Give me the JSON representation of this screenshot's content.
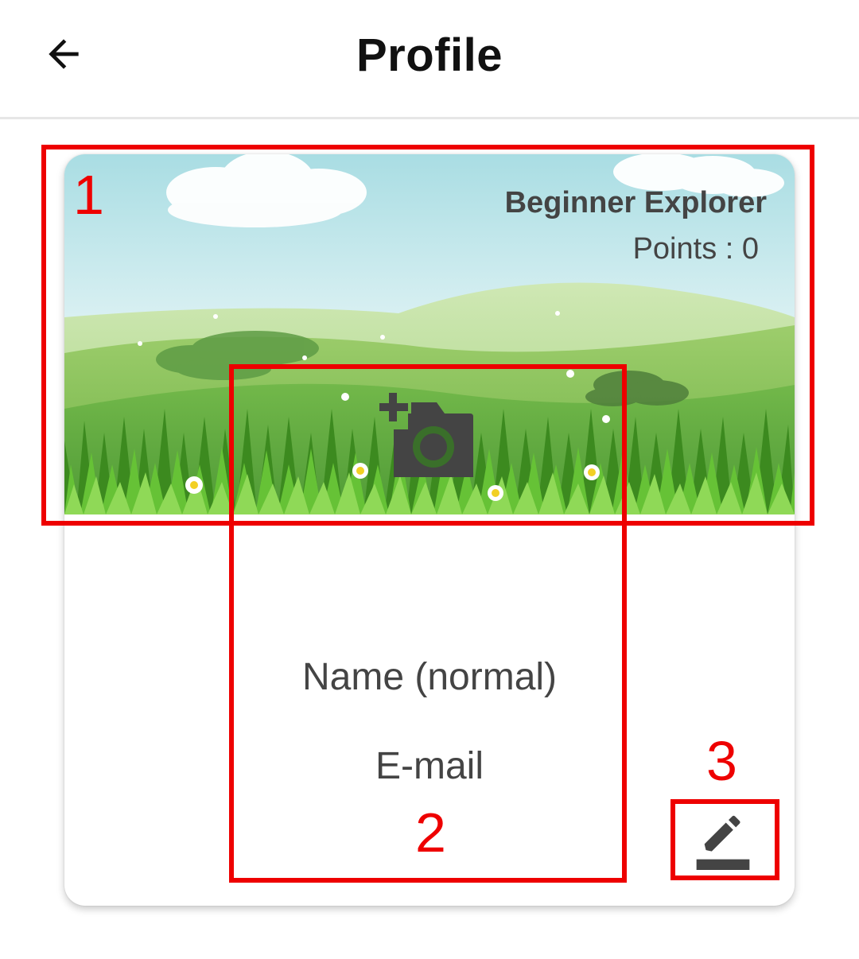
{
  "header": {
    "title": "Profile",
    "back_icon": "arrow-left-icon"
  },
  "profile": {
    "rank": "Beginner Explorer",
    "points": "Points : 0",
    "name": "Name (normal)",
    "email": "E-mail",
    "camera_icon": "add-photo-camera-icon",
    "edit_icon": "edit-pencil-icon"
  },
  "annotations": {
    "one": "1",
    "two": "2",
    "three": "3",
    "color": "#ee0000"
  }
}
